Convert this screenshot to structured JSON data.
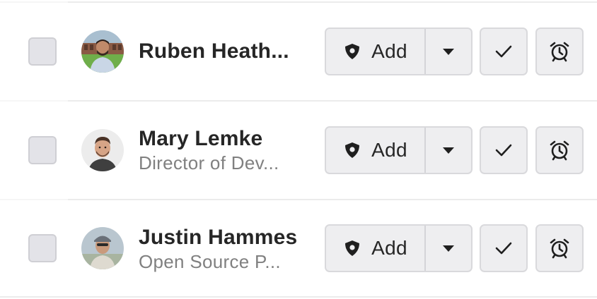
{
  "contacts": [
    {
      "name": "Ruben Heath...",
      "title": "",
      "avatar": "avatar-ruben",
      "add_label": "Add"
    },
    {
      "name": "Mary Lemke",
      "title": "Director of Dev...",
      "avatar": "avatar-mary",
      "add_label": "Add"
    },
    {
      "name": "Justin Hammes",
      "title": "Open Source P...",
      "avatar": "avatar-justin",
      "add_label": "Add"
    }
  ],
  "icons": {
    "add": "shield-pin-icon",
    "dropdown": "caret-down-icon",
    "mark_done": "check-icon",
    "snooze": "alarm-clock-icon"
  },
  "colors": {
    "button_bg": "#eeeef0",
    "button_border": "#d9d9dc",
    "checkbox_bg": "#e3e3e8",
    "name": "#262626",
    "subtitle": "#808080"
  }
}
